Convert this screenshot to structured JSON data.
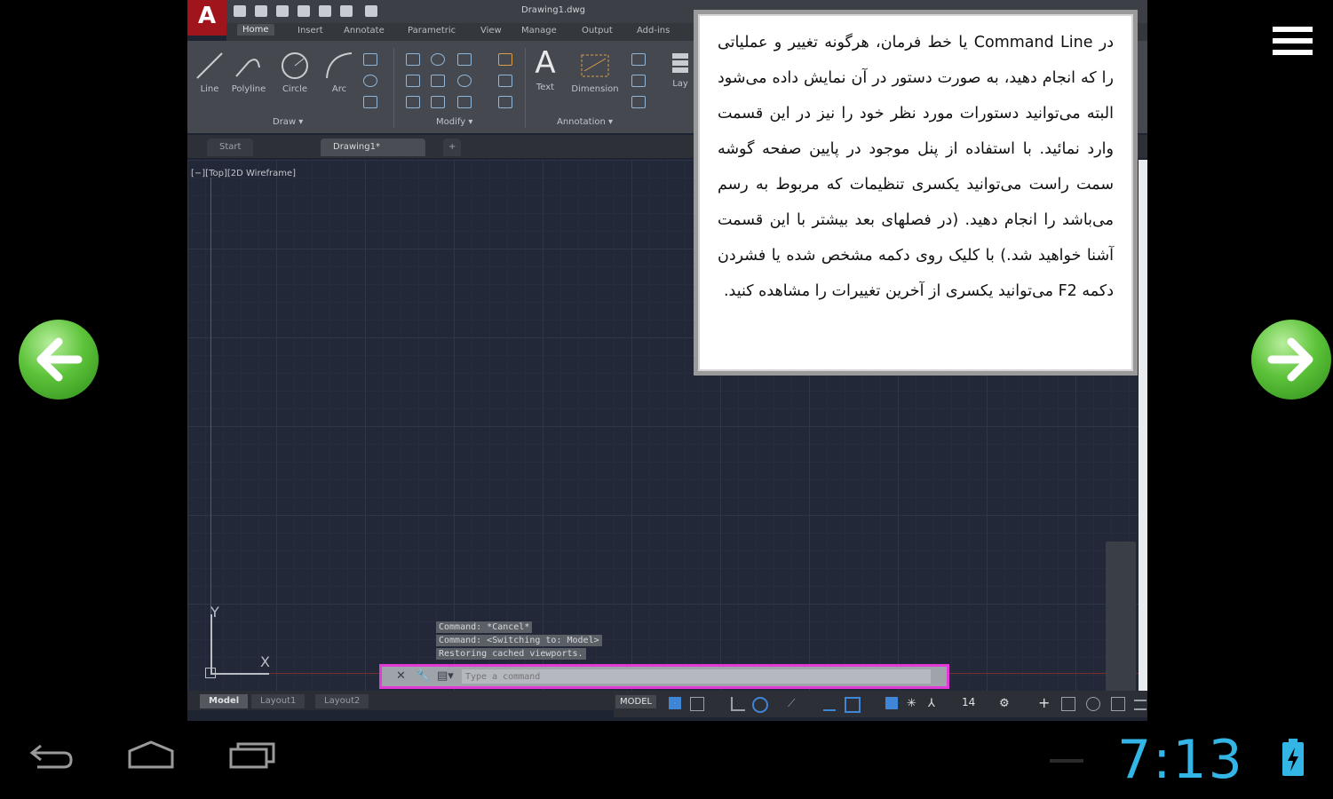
{
  "autocad": {
    "logo": "A",
    "document_title": "Drawing1.dwg",
    "tabs": [
      "Home",
      "Insert",
      "Annotate",
      "Parametric",
      "View",
      "Manage",
      "Output",
      "Add-ins"
    ],
    "draw_tools": [
      "Line",
      "Polyline",
      "Circle",
      "Arc"
    ],
    "annotation_tools": [
      "Text",
      "Dimension"
    ],
    "layers_label": "Lay",
    "panels": [
      "Draw ▾",
      "Modify ▾",
      "Annotation ▾"
    ],
    "file_tabs": [
      "Start",
      "Drawing1*"
    ],
    "new_tab": "+",
    "viewport_label": "[−][Top][2D Wireframe]",
    "ucs": {
      "y": "Y",
      "x": "X"
    },
    "command_history": [
      "Command: *Cancel*",
      "Command:  <Switching to: Model>",
      "Restoring cached viewports."
    ],
    "command_placeholder": "Type a command",
    "layout_tabs": [
      "Model",
      "Layout1",
      "Layout2"
    ],
    "status": {
      "model": "MODEL",
      "scale": "14"
    }
  },
  "tutorial_text": "در Command Line یا خط فرمان، هرگونه تغییر و عملیاتی را که انجام دهید، به صورت دستور در آن نمایش داده می‌شود البته می‌توانید دستورات مورد نظر خود را نیز در این قسمت وارد نمائید. با استفاده از پنل موجود در پایین صفحه گوشه سمت راست می‌توانید یکسری تنظیمات که مربوط به رسم می‌باشد را انجام دهید. (در فصلهای بعد بیشتر با این قسمت آشنا خواهید شد.) با کلیک روی دکمه مشخص شده یا فشردن دکمه F2 می‌توانید یکسری از آخرین تغییرات را مشاهده کنید.",
  "system": {
    "clock": "7:13"
  },
  "colors": {
    "highlight": "#e23ad6",
    "clock": "#33b5e5",
    "arrow": "#4cb82d"
  },
  "icons": [
    "menu-icon",
    "back-arrow-icon",
    "forward-arrow-icon",
    "android-back-icon",
    "android-home-icon",
    "android-recents-icon",
    "battery-charging-icon"
  ]
}
